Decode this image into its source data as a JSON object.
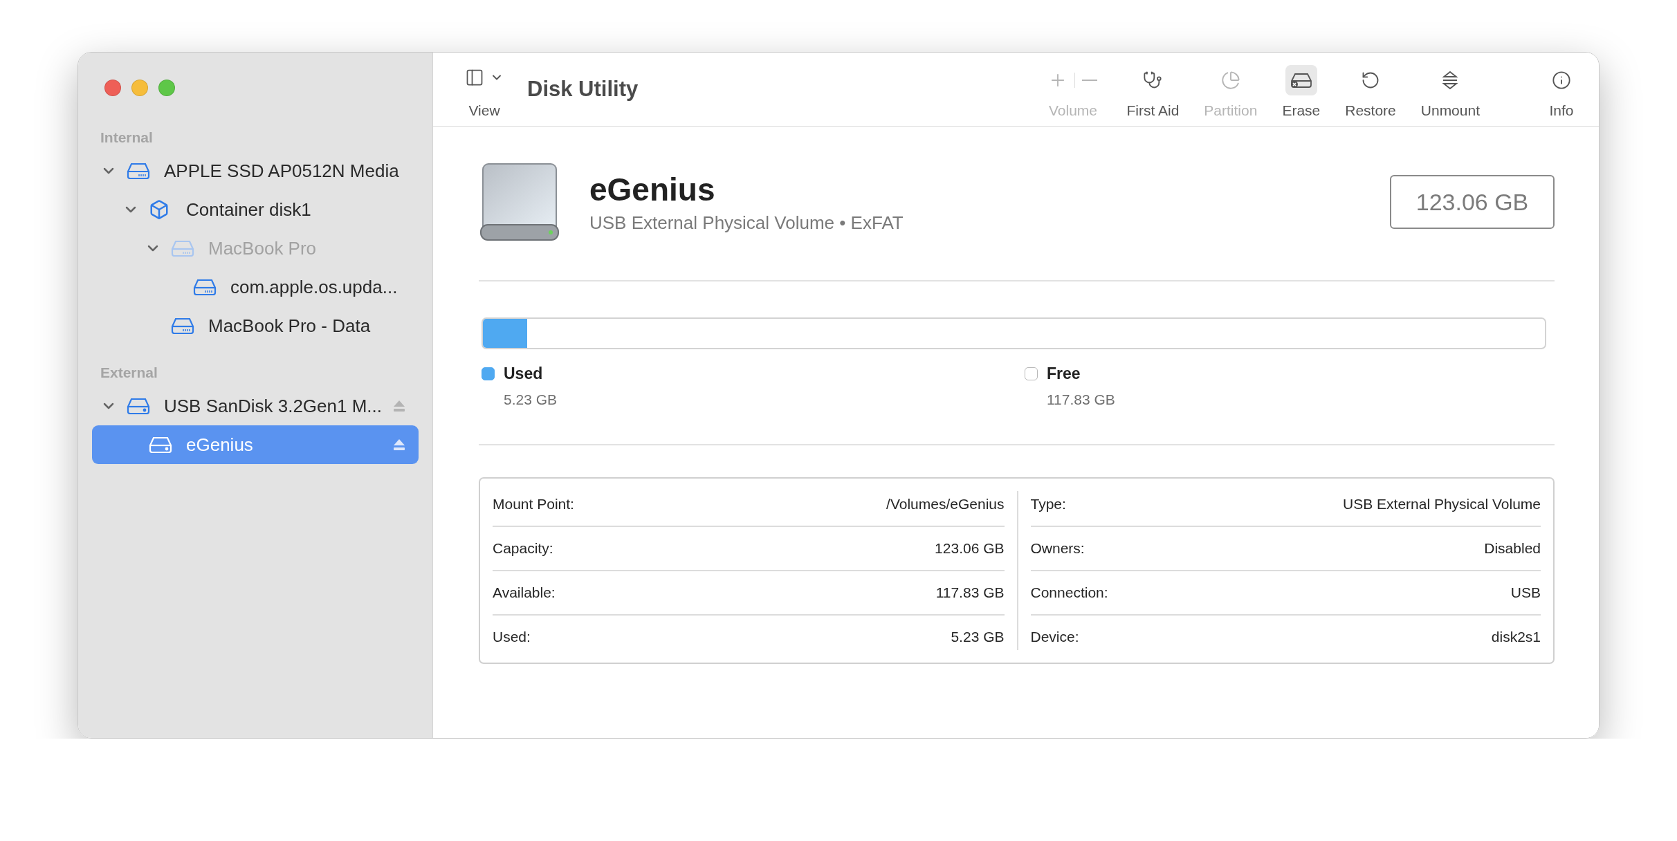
{
  "window": {
    "title": "Disk Utility"
  },
  "toolbar": {
    "view": {
      "label": "View"
    },
    "buttons": [
      {
        "kind": "volume",
        "label": "Volume",
        "disabled": true,
        "highlighted": false
      },
      {
        "kind": "first_aid",
        "label": "First Aid",
        "disabled": false,
        "highlighted": false
      },
      {
        "kind": "partition",
        "label": "Partition",
        "disabled": true,
        "highlighted": false
      },
      {
        "kind": "erase",
        "label": "Erase",
        "disabled": false,
        "highlighted": true
      },
      {
        "kind": "restore",
        "label": "Restore",
        "disabled": false,
        "highlighted": false
      },
      {
        "kind": "unmount",
        "label": "Unmount",
        "disabled": false,
        "highlighted": false
      },
      {
        "kind": "info",
        "label": "Info",
        "disabled": false,
        "highlighted": false
      }
    ]
  },
  "sidebar": {
    "sections": [
      {
        "heading": "Internal",
        "items": [
          {
            "kind": "disk",
            "label": "APPLE SSD AP0512N Media",
            "expanded": true,
            "disabled": false,
            "selected": false,
            "ejectable": false,
            "children": [
              {
                "kind": "container",
                "label": "Container disk1",
                "expanded": true,
                "disabled": false,
                "selected": false,
                "ejectable": false,
                "children": [
                  {
                    "kind": "disk",
                    "label": "MacBook Pro",
                    "expanded": true,
                    "disabled": true,
                    "selected": false,
                    "ejectable": false,
                    "children": [
                      {
                        "kind": "disk",
                        "label": "com.apple.os.upda...",
                        "disabled": false,
                        "selected": false,
                        "ejectable": false
                      }
                    ]
                  },
                  {
                    "kind": "disk",
                    "label": "MacBook Pro - Data",
                    "disabled": false,
                    "selected": false,
                    "ejectable": false
                  }
                ]
              }
            ]
          }
        ]
      },
      {
        "heading": "External",
        "items": [
          {
            "kind": "volume",
            "label": "USB SanDisk 3.2Gen1 M...",
            "expanded": true,
            "disabled": false,
            "selected": false,
            "ejectable": true,
            "children": [
              {
                "kind": "volume",
                "label": "eGenius",
                "disabled": false,
                "selected": true,
                "ejectable": true
              }
            ]
          }
        ]
      }
    ]
  },
  "volume": {
    "name": "eGenius",
    "subtitle": "USB External Physical Volume • ExFAT",
    "capacity": "123.06 GB"
  },
  "usage": {
    "level": 0.042,
    "legend": [
      {
        "label": "Used",
        "value": "5.23 GB",
        "color": "#4fa9f1"
      },
      {
        "label": "Free",
        "value": "117.83 GB",
        "color": "#ffffff"
      }
    ]
  },
  "details": {
    "columns": [
      [
        {
          "label": "Mount Point:",
          "value": "/Volumes/eGenius"
        },
        {
          "label": "Capacity:",
          "value": "123.06 GB"
        },
        {
          "label": "Available:",
          "value": "117.83 GB"
        },
        {
          "label": "Used:",
          "value": "5.23 GB"
        }
      ],
      [
        {
          "label": "Type:",
          "value": "USB External Physical Volume"
        },
        {
          "label": "Owners:",
          "value": "Disabled"
        },
        {
          "label": "Connection:",
          "value": "USB"
        },
        {
          "label": "Device:",
          "value": "disk2s1"
        }
      ]
    ]
  }
}
